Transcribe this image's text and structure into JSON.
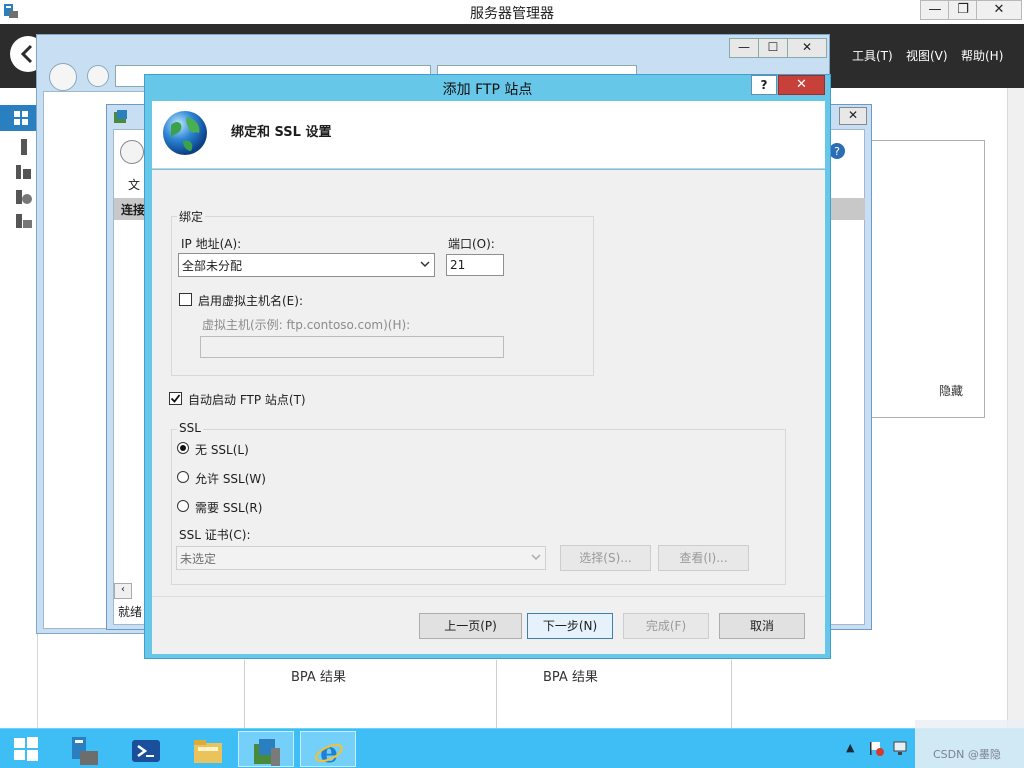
{
  "server_manager": {
    "title": "服务器管理器",
    "window_controls": [
      "—",
      "❐",
      "✕"
    ],
    "menu": {
      "tools": "工具(T)",
      "view": "视图(V)",
      "help": "帮助(H)"
    },
    "tiles": [
      "BPA 结果",
      "BPA 结果"
    ],
    "hidden_label": "隐藏"
  },
  "ie": {
    "controls": [
      "—",
      "☐",
      "✕"
    ]
  },
  "iis": {
    "menu_file": "文",
    "connections": "连接",
    "status": "就绪",
    "close": "✕"
  },
  "dialog": {
    "title": "添加 FTP 站点",
    "help": "?",
    "close": "✕",
    "heading": "绑定和 SSL 设置",
    "binding": {
      "group_label": "绑定",
      "ip_label": "IP 地址(A):",
      "ip_value": "全部未分配",
      "port_label": "端口(O):",
      "port_value": "21",
      "vhost_checkbox_label": "启用虚拟主机名(E):",
      "vhost_checked": false,
      "vhost_label": "虚拟主机(示例: ftp.contoso.com)(H):",
      "vhost_value": ""
    },
    "autostart": {
      "label": "自动启动 FTP 站点(T)",
      "checked": true
    },
    "ssl": {
      "group_label": "SSL",
      "options": [
        {
          "label": "无 SSL(L)",
          "selected": true
        },
        {
          "label": "允许 SSL(W)",
          "selected": false
        },
        {
          "label": "需要 SSL(R)",
          "selected": false
        }
      ],
      "cert_label": "SSL 证书(C):",
      "cert_value": "未选定",
      "select_button": "选择(S)...",
      "view_button": "查看(I)..."
    },
    "buttons": {
      "prev": "上一页(P)",
      "next": "下一步(N)",
      "finish": "完成(F)",
      "cancel": "取消"
    }
  },
  "taskbar": {
    "watermark": "CSDN @墨隐"
  }
}
